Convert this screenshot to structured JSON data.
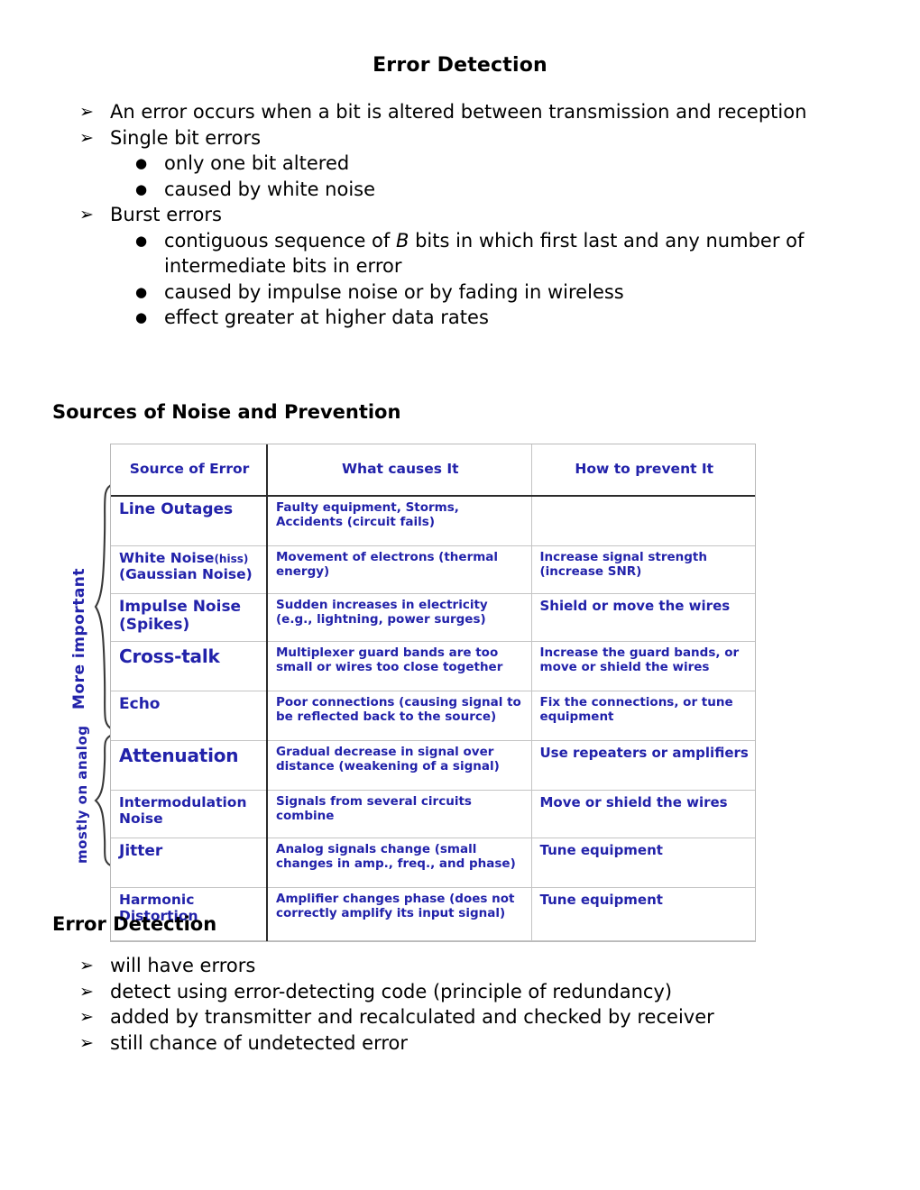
{
  "document": {
    "title": "Error Detection"
  },
  "section_errors": {
    "bullets": [
      {
        "level": 1,
        "marker": "➢",
        "text": "An error occurs when a bit is altered between transmission and reception",
        "justified": true
      },
      {
        "level": 1,
        "marker": "➢",
        "text": "Single bit errors",
        "justified": false
      },
      {
        "level": 2,
        "marker": "●",
        "text": "only one bit altered"
      },
      {
        "level": 2,
        "marker": "●",
        "text": "caused by white noise"
      },
      {
        "level": 1,
        "marker": "➢",
        "text": "Burst errors",
        "justified": false
      },
      {
        "level": 2,
        "marker": "●",
        "text_before": "contiguous sequence of ",
        "emphasis": "B",
        "text_after": " bits in which first last and any number of intermediate bits in error"
      },
      {
        "level": 2,
        "marker": "●",
        "text": "caused by impulse noise or by fading in wireless"
      },
      {
        "level": 2,
        "marker": "●",
        "text": "effect greater at higher data rates"
      }
    ]
  },
  "section_noise": {
    "heading": "Sources of Noise and Prevention",
    "accent_color": "#2222AA",
    "brace_labels": [
      {
        "id": "more-important",
        "text": "More important"
      },
      {
        "id": "mostly-on-analog",
        "text": "mostly on analog"
      }
    ],
    "table": {
      "columns": [
        "Source of Error",
        "What causes It",
        "How to prevent It"
      ],
      "rows": [
        {
          "source": "Line Outages",
          "source_sub": "",
          "cause": "Faulty equipment, Storms, Accidents (circuit fails)",
          "prevent": ""
        },
        {
          "source": "White Noise",
          "source_small": "(hiss)",
          "source_sub": "(Gaussian Noise)",
          "cause": "Movement of electrons (thermal energy)",
          "prevent": "Increase signal strength (increase SNR)"
        },
        {
          "source": "Impulse Noise",
          "source_sub": "(Spikes)",
          "cause": "Sudden increases in electricity (e.g., lightning, power surges)",
          "prevent": "Shield  or move the wires"
        },
        {
          "source": "Cross-talk",
          "source_sub": "",
          "cause": "Multiplexer guard bands are too small or wires too close together",
          "prevent": "Increase the guard bands, or move or shield the wires"
        },
        {
          "source": "Echo",
          "source_sub": "",
          "cause": "Poor connections (causing signal to be reflected back to the source)",
          "prevent": "Fix the connections, or tune equipment"
        },
        {
          "source": "Attenuation",
          "source_sub": "",
          "cause": "Gradual decrease in signal over distance (weakening of a signal)",
          "prevent": "Use repeaters or amplifiers"
        },
        {
          "source": "Intermodulation",
          "source_sub": "Noise",
          "cause": "Signals from several circuits combine",
          "prevent": "Move or shield the wires"
        },
        {
          "source": "Jitter",
          "source_sub": "",
          "cause": "Analog signals change (small changes in amp., freq., and phase)",
          "prevent": "Tune equipment"
        },
        {
          "source": "Harmonic",
          "source_sub": "Distortion",
          "cause": "Amplifier changes phase (does not correctly amplify its input signal)",
          "prevent": "Tune equipment"
        }
      ]
    }
  },
  "section_detection": {
    "heading": "Error Detection",
    "bullets": [
      {
        "marker": "➢",
        "text": "will have errors"
      },
      {
        "marker": "➢",
        "text": "detect using error-detecting code (principle of redundancy)"
      },
      {
        "marker": "➢",
        "text": "added by transmitter and recalculated and checked by receiver"
      },
      {
        "marker": "➢",
        "text": "still chance of undetected error"
      }
    ]
  }
}
